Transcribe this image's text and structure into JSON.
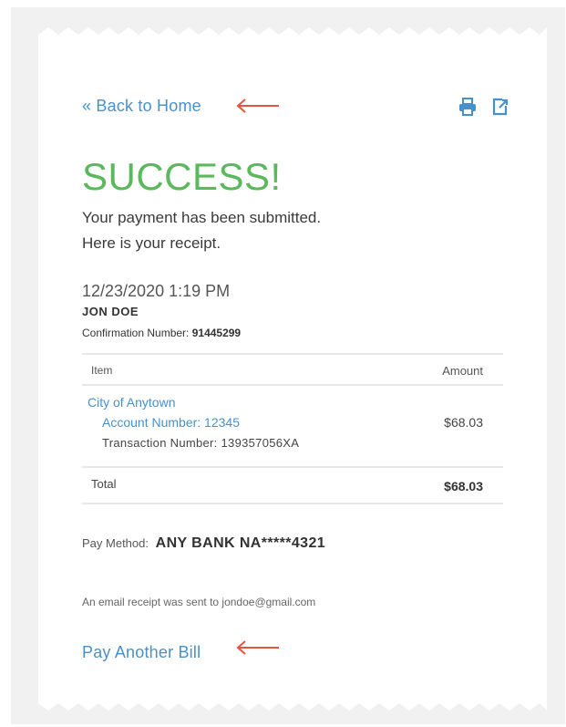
{
  "nav": {
    "back_label": "« Back to Home",
    "print_icon": "printer-icon",
    "export_icon": "export-icon"
  },
  "status": {
    "heading": "SUCCESS!",
    "message_line1": "Your payment has been submitted.",
    "message_line2": "Here is your receipt."
  },
  "receipt": {
    "datetime": "12/23/2020 1:19 PM",
    "customer_name": "JON DOE",
    "confirmation_label": "Confirmation Number:",
    "confirmation_number": "91445299",
    "table": {
      "header_item": "Item",
      "header_amount": "Amount",
      "items": [
        {
          "name": "City of Anytown",
          "account": "Account Number: 12345",
          "transaction": "Transaction Number: 139357056XA",
          "amount": "$68.03"
        }
      ],
      "total_label": "Total",
      "total_amount": "$68.03"
    },
    "pay_method_label": "Pay Method:",
    "pay_method_value": "ANY BANK NA*****4321",
    "email_note": "An email receipt was sent to jondoe@gmail.com"
  },
  "actions": {
    "pay_another_label": "Pay Another Bill"
  },
  "colors": {
    "success": "#5cb85c",
    "link": "#4a90c8",
    "annotation_arrow": "#e8533f"
  }
}
